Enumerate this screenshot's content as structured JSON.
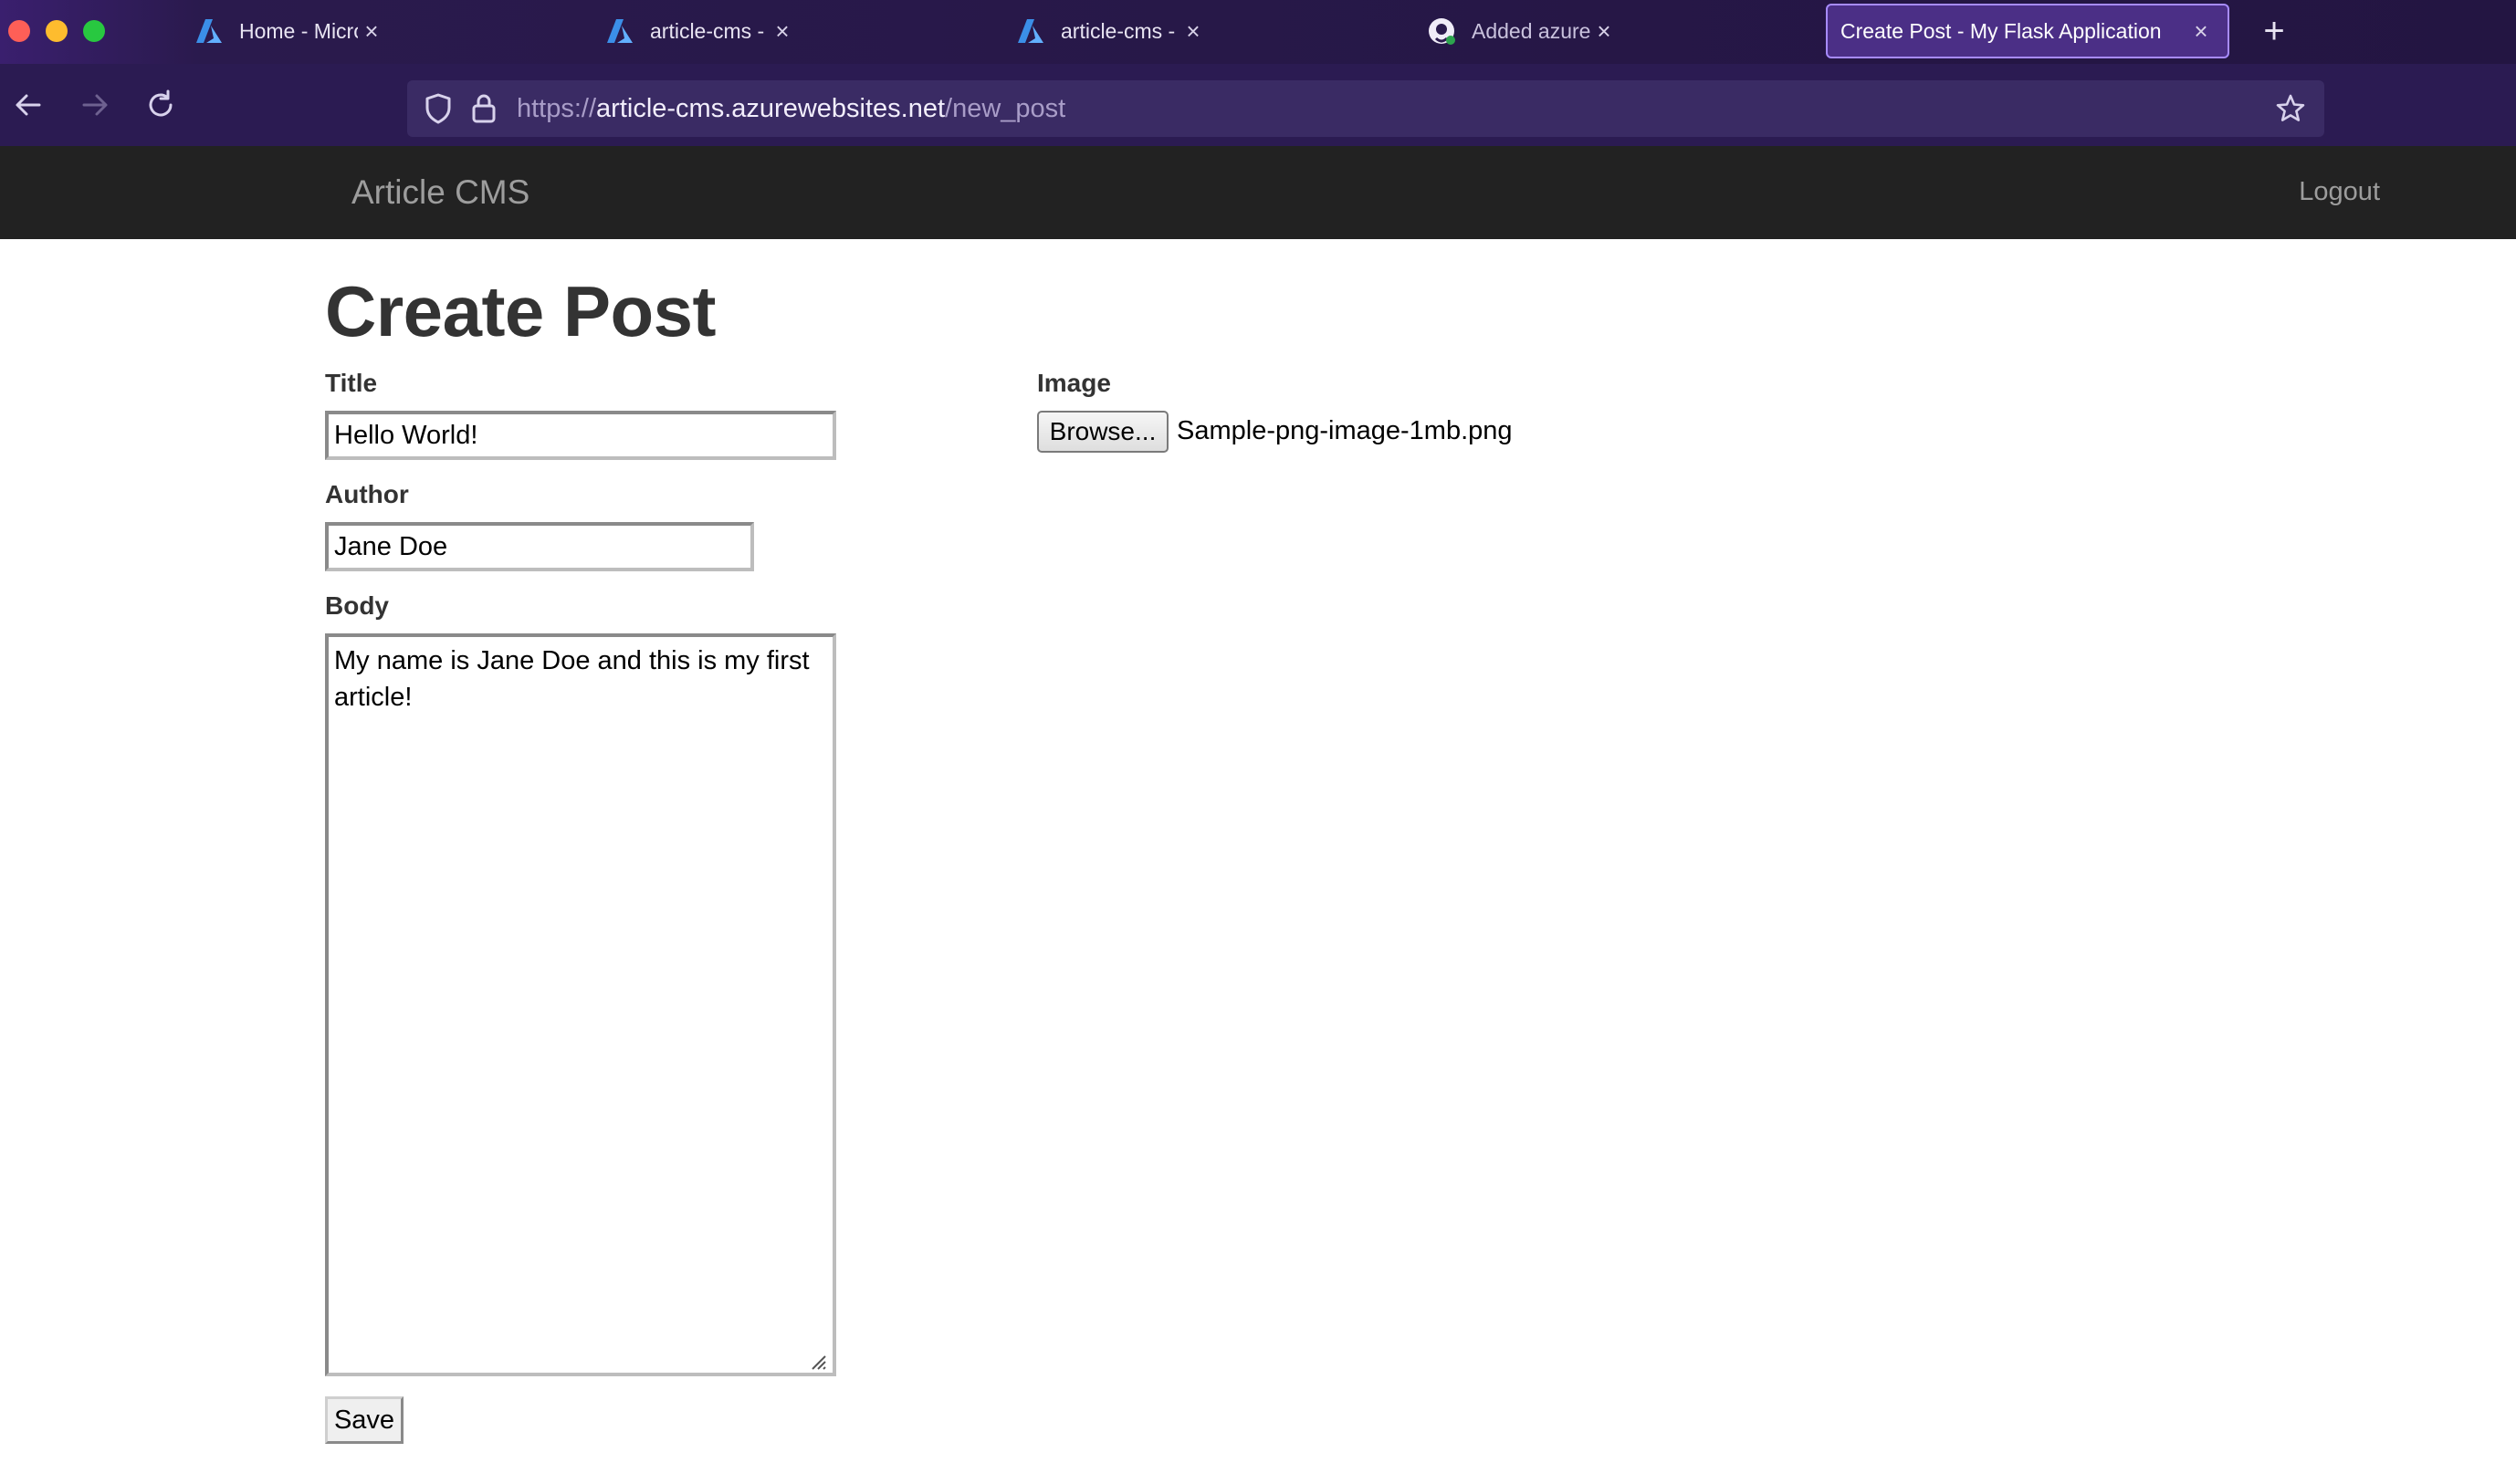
{
  "browser": {
    "tabs": [
      {
        "label": "Home - Microsoft Azure",
        "icon": "azure-icon",
        "active": false
      },
      {
        "label": "article-cms - Microsoft Azure",
        "icon": "azure-icon",
        "active": false
      },
      {
        "label": "article-cms - Microsoft Azure",
        "icon": "azure-icon",
        "active": false
      },
      {
        "label": "Added azure AD keys into confi",
        "icon": "github-icon",
        "active": false
      },
      {
        "label": "Create Post - My Flask Application",
        "icon": "",
        "active": true
      }
    ],
    "tab_close_glyph": "×",
    "new_tab_glyph": "+",
    "url": {
      "scheme": "https://",
      "host": "article-cms.azurewebsites.net",
      "path": "/new_post"
    },
    "colors": {
      "accent": "#a78bff",
      "chrome": "#2b1b52"
    }
  },
  "site": {
    "brand": "Article CMS",
    "logout": "Logout"
  },
  "form": {
    "heading": "Create Post",
    "title_label": "Title",
    "title_value": "Hello World!",
    "author_label": "Author",
    "author_value": "Jane Doe",
    "body_label": "Body",
    "body_value": "My name is Jane Doe and this is my first article!",
    "image_label": "Image",
    "browse_label": "Browse...",
    "file_name": "Sample-png-image-1mb.png",
    "save_label": "Save"
  }
}
